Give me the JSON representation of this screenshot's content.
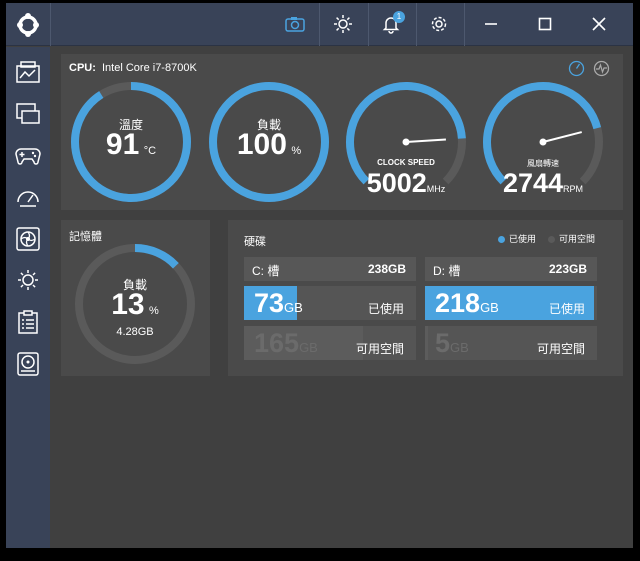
{
  "topbar": {
    "notification_count": "1",
    "icons": [
      "logo-icon",
      "camera-icon",
      "brightness-icon",
      "bell-icon",
      "gear-icon",
      "minimize-icon",
      "maximize-icon",
      "close-icon"
    ]
  },
  "sidebar": {
    "items": [
      "dashboard-icon",
      "monitor-icon",
      "gamepad-icon",
      "speedometer-icon",
      "fan-icon",
      "brightness-icon",
      "clipboard-icon",
      "disk-icon"
    ]
  },
  "cpu": {
    "label": "CPU:",
    "model": "Intel Core i7-8700K",
    "temp": {
      "title": "溫度",
      "value": "91",
      "unit": "°C",
      "percent": 0.91
    },
    "load": {
      "title": "負載",
      "value": "100",
      "unit": "%",
      "percent": 1.0
    },
    "clock": {
      "title": "CLOCK SPEED",
      "value": "5002",
      "unit": "MHz",
      "percent": 0.82
    },
    "fan": {
      "title": "風扇轉速",
      "value": "2744",
      "unit": "RPM",
      "percent": 0.78
    }
  },
  "memory": {
    "title": "記憶體",
    "load_title": "負載",
    "value": "13",
    "unit": "%",
    "percent": 0.13,
    "size": "4.28GB"
  },
  "disk": {
    "title": "硬碟",
    "legend_used": "已使用",
    "legend_free": "可用空間",
    "drives": [
      {
        "name": "C: 槽",
        "total": "238GB",
        "used": "73",
        "free": "165",
        "unit": "GB",
        "used_label": "已使用",
        "free_label": "可用空間",
        "used_fraction": 0.31,
        "free_fraction": 0.69
      },
      {
        "name": "D: 槽",
        "total": "223GB",
        "used": "218",
        "free": "5",
        "unit": "GB",
        "used_label": "已使用",
        "free_label": "可用空間",
        "used_fraction": 0.98,
        "free_fraction": 0.02
      }
    ]
  },
  "colors": {
    "accent": "#4aa3df",
    "track": "#5a5a5a",
    "panel": "#4a4a4a",
    "sidebar": "#394358"
  }
}
